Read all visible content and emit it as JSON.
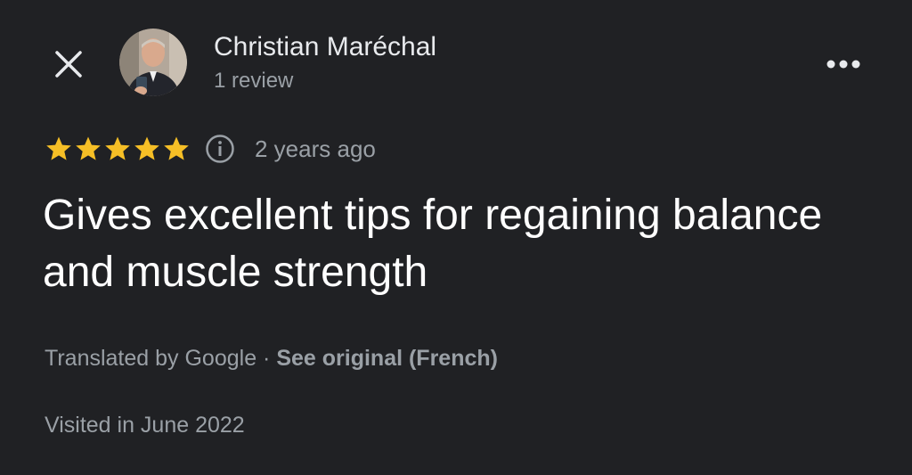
{
  "header": {
    "close_icon": "close-icon",
    "more_icon": "more-horizontal-icon",
    "author": {
      "name": "Christian Maréchal",
      "review_count": "1 review",
      "avatar": "profile-photo"
    }
  },
  "review": {
    "rating": 5,
    "max_rating": 5,
    "star_color": "#f6bf26",
    "info_icon": "info-icon",
    "time": "2 years ago",
    "text": "Gives excellent tips for regaining balance and muscle strength",
    "translated_label": "Translated by Google",
    "separator": " · ",
    "see_original_label": "See original (French)",
    "visited": "Visited in June 2022"
  },
  "colors": {
    "background": "#202124",
    "primary_text": "#ffffff",
    "secondary_text": "#9aa0a6"
  }
}
